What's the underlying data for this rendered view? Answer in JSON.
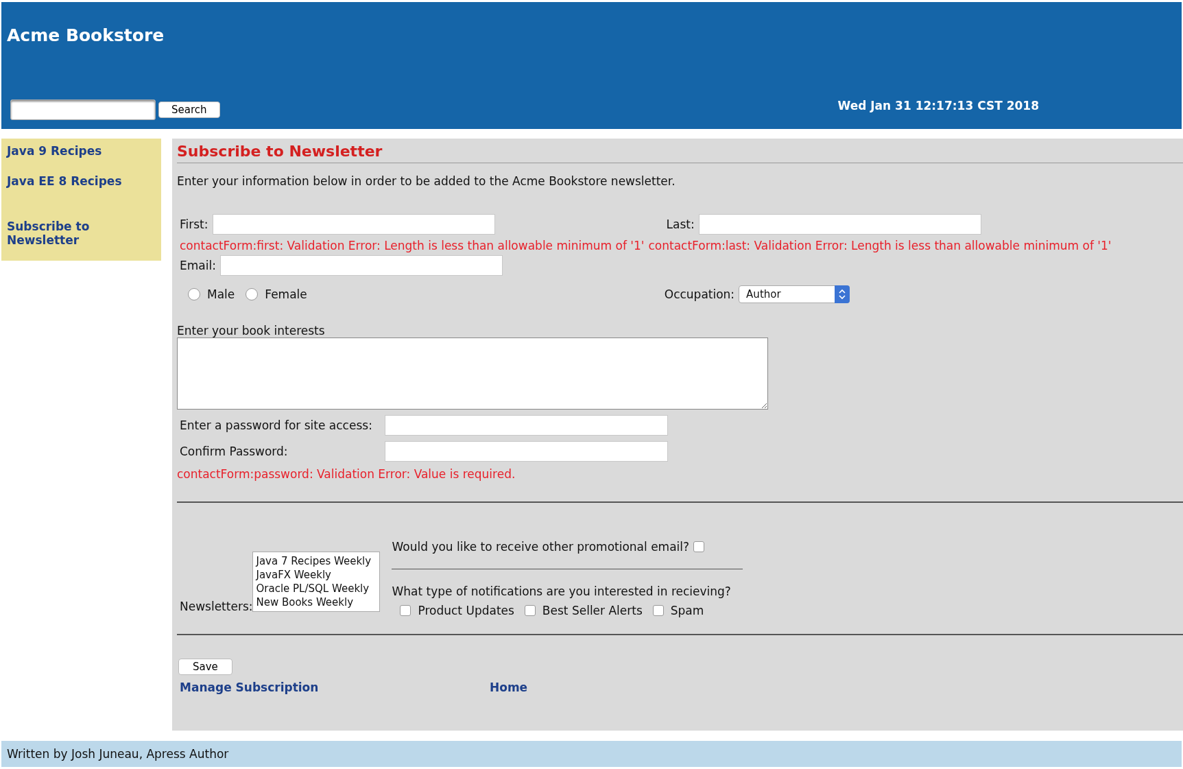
{
  "header": {
    "title": "Acme Bookstore",
    "search": {
      "button": "Search"
    },
    "datetime": "Wed Jan 31 12:17:13 CST 2018"
  },
  "sidebar": {
    "items": [
      {
        "label": "Java 9 Recipes"
      },
      {
        "label": "Java EE 8 Recipes"
      },
      {
        "label": "Subscribe to Newsletter"
      }
    ]
  },
  "form": {
    "heading": "Subscribe to Newsletter",
    "intro": "Enter your information below in order to be added to the Acme Bookstore newsletter.",
    "first_label": "First:",
    "last_label": "Last:",
    "errors": [
      "contactForm:first: Validation Error: Length is less than allowable minimum of '1'",
      "contactForm:last: Validation Error: Length is less than allowable minimum of '1'"
    ],
    "email_label": "Email:",
    "gender": [
      {
        "label": "Male",
        "selected": false
      },
      {
        "label": "Female",
        "selected": false
      }
    ],
    "occupation": {
      "label": "Occupation:",
      "value": "Author"
    },
    "interests_label": "Enter your book interests",
    "password_label": "Enter a password for site access:",
    "confirm_label": "Confirm Password:",
    "password_error": "contactForm:password: Validation Error: Value is required.",
    "newsletters": {
      "label": "Newsletters:",
      "options": [
        {
          "label": "Java 7 Recipes Weekly",
          "selected": false
        },
        {
          "label": "JavaFX Weekly",
          "selected": false
        },
        {
          "label": "Oracle PL/SQL Weekly",
          "selected": false
        },
        {
          "label": "New Books Weekly",
          "selected": false
        }
      ]
    },
    "promo": {
      "question": "Would you like to receive other promotional email?",
      "checked": false
    },
    "notifications": {
      "question": "What type of notifications are you interested in recieving?",
      "options": [
        {
          "label": "Product Updates",
          "checked": false
        },
        {
          "label": "Best Seller Alerts",
          "checked": false
        },
        {
          "label": "Spam",
          "checked": false
        }
      ]
    },
    "save": "Save",
    "links": [
      "Manage Subscription",
      "Home"
    ]
  },
  "footer": {
    "text": "Written by Josh Juneau, Apress Author"
  }
}
